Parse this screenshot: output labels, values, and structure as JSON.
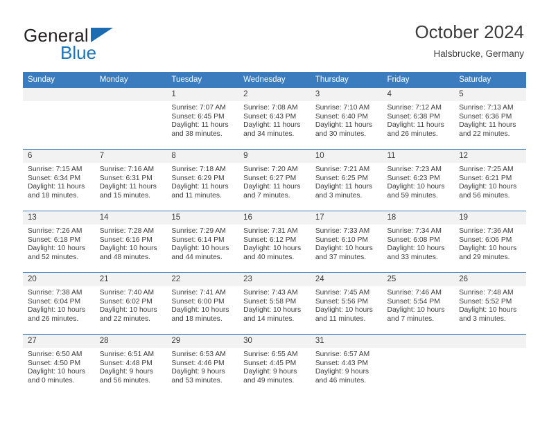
{
  "brand": {
    "name_part1": "General",
    "name_part2": "Blue",
    "logo_icon": "triangle-icon",
    "accent_color": "#1b75bb"
  },
  "header": {
    "title": "October 2024",
    "subtitle": "Halsbrucke, Germany"
  },
  "calendar": {
    "header_background": "#3a7cbe",
    "daynum_background": "#f2f2f2",
    "weekday_headers": [
      "Sunday",
      "Monday",
      "Tuesday",
      "Wednesday",
      "Thursday",
      "Friday",
      "Saturday"
    ],
    "weeks": [
      [
        {
          "day": "",
          "blank": true
        },
        {
          "day": "",
          "blank": true
        },
        {
          "day": "1",
          "sunrise": "Sunrise: 7:07 AM",
          "sunset": "Sunset: 6:45 PM",
          "daylight1": "Daylight: 11 hours",
          "daylight2": "and 38 minutes."
        },
        {
          "day": "2",
          "sunrise": "Sunrise: 7:08 AM",
          "sunset": "Sunset: 6:43 PM",
          "daylight1": "Daylight: 11 hours",
          "daylight2": "and 34 minutes."
        },
        {
          "day": "3",
          "sunrise": "Sunrise: 7:10 AM",
          "sunset": "Sunset: 6:40 PM",
          "daylight1": "Daylight: 11 hours",
          "daylight2": "and 30 minutes."
        },
        {
          "day": "4",
          "sunrise": "Sunrise: 7:12 AM",
          "sunset": "Sunset: 6:38 PM",
          "daylight1": "Daylight: 11 hours",
          "daylight2": "and 26 minutes."
        },
        {
          "day": "5",
          "sunrise": "Sunrise: 7:13 AM",
          "sunset": "Sunset: 6:36 PM",
          "daylight1": "Daylight: 11 hours",
          "daylight2": "and 22 minutes."
        }
      ],
      [
        {
          "day": "6",
          "sunrise": "Sunrise: 7:15 AM",
          "sunset": "Sunset: 6:34 PM",
          "daylight1": "Daylight: 11 hours",
          "daylight2": "and 18 minutes."
        },
        {
          "day": "7",
          "sunrise": "Sunrise: 7:16 AM",
          "sunset": "Sunset: 6:31 PM",
          "daylight1": "Daylight: 11 hours",
          "daylight2": "and 15 minutes."
        },
        {
          "day": "8",
          "sunrise": "Sunrise: 7:18 AM",
          "sunset": "Sunset: 6:29 PM",
          "daylight1": "Daylight: 11 hours",
          "daylight2": "and 11 minutes."
        },
        {
          "day": "9",
          "sunrise": "Sunrise: 7:20 AM",
          "sunset": "Sunset: 6:27 PM",
          "daylight1": "Daylight: 11 hours",
          "daylight2": "and 7 minutes."
        },
        {
          "day": "10",
          "sunrise": "Sunrise: 7:21 AM",
          "sunset": "Sunset: 6:25 PM",
          "daylight1": "Daylight: 11 hours",
          "daylight2": "and 3 minutes."
        },
        {
          "day": "11",
          "sunrise": "Sunrise: 7:23 AM",
          "sunset": "Sunset: 6:23 PM",
          "daylight1": "Daylight: 10 hours",
          "daylight2": "and 59 minutes."
        },
        {
          "day": "12",
          "sunrise": "Sunrise: 7:25 AM",
          "sunset": "Sunset: 6:21 PM",
          "daylight1": "Daylight: 10 hours",
          "daylight2": "and 56 minutes."
        }
      ],
      [
        {
          "day": "13",
          "sunrise": "Sunrise: 7:26 AM",
          "sunset": "Sunset: 6:18 PM",
          "daylight1": "Daylight: 10 hours",
          "daylight2": "and 52 minutes."
        },
        {
          "day": "14",
          "sunrise": "Sunrise: 7:28 AM",
          "sunset": "Sunset: 6:16 PM",
          "daylight1": "Daylight: 10 hours",
          "daylight2": "and 48 minutes."
        },
        {
          "day": "15",
          "sunrise": "Sunrise: 7:29 AM",
          "sunset": "Sunset: 6:14 PM",
          "daylight1": "Daylight: 10 hours",
          "daylight2": "and 44 minutes."
        },
        {
          "day": "16",
          "sunrise": "Sunrise: 7:31 AM",
          "sunset": "Sunset: 6:12 PM",
          "daylight1": "Daylight: 10 hours",
          "daylight2": "and 40 minutes."
        },
        {
          "day": "17",
          "sunrise": "Sunrise: 7:33 AM",
          "sunset": "Sunset: 6:10 PM",
          "daylight1": "Daylight: 10 hours",
          "daylight2": "and 37 minutes."
        },
        {
          "day": "18",
          "sunrise": "Sunrise: 7:34 AM",
          "sunset": "Sunset: 6:08 PM",
          "daylight1": "Daylight: 10 hours",
          "daylight2": "and 33 minutes."
        },
        {
          "day": "19",
          "sunrise": "Sunrise: 7:36 AM",
          "sunset": "Sunset: 6:06 PM",
          "daylight1": "Daylight: 10 hours",
          "daylight2": "and 29 minutes."
        }
      ],
      [
        {
          "day": "20",
          "sunrise": "Sunrise: 7:38 AM",
          "sunset": "Sunset: 6:04 PM",
          "daylight1": "Daylight: 10 hours",
          "daylight2": "and 26 minutes."
        },
        {
          "day": "21",
          "sunrise": "Sunrise: 7:40 AM",
          "sunset": "Sunset: 6:02 PM",
          "daylight1": "Daylight: 10 hours",
          "daylight2": "and 22 minutes."
        },
        {
          "day": "22",
          "sunrise": "Sunrise: 7:41 AM",
          "sunset": "Sunset: 6:00 PM",
          "daylight1": "Daylight: 10 hours",
          "daylight2": "and 18 minutes."
        },
        {
          "day": "23",
          "sunrise": "Sunrise: 7:43 AM",
          "sunset": "Sunset: 5:58 PM",
          "daylight1": "Daylight: 10 hours",
          "daylight2": "and 14 minutes."
        },
        {
          "day": "24",
          "sunrise": "Sunrise: 7:45 AM",
          "sunset": "Sunset: 5:56 PM",
          "daylight1": "Daylight: 10 hours",
          "daylight2": "and 11 minutes."
        },
        {
          "day": "25",
          "sunrise": "Sunrise: 7:46 AM",
          "sunset": "Sunset: 5:54 PM",
          "daylight1": "Daylight: 10 hours",
          "daylight2": "and 7 minutes."
        },
        {
          "day": "26",
          "sunrise": "Sunrise: 7:48 AM",
          "sunset": "Sunset: 5:52 PM",
          "daylight1": "Daylight: 10 hours",
          "daylight2": "and 3 minutes."
        }
      ],
      [
        {
          "day": "27",
          "sunrise": "Sunrise: 6:50 AM",
          "sunset": "Sunset: 4:50 PM",
          "daylight1": "Daylight: 10 hours",
          "daylight2": "and 0 minutes."
        },
        {
          "day": "28",
          "sunrise": "Sunrise: 6:51 AM",
          "sunset": "Sunset: 4:48 PM",
          "daylight1": "Daylight: 9 hours",
          "daylight2": "and 56 minutes."
        },
        {
          "day": "29",
          "sunrise": "Sunrise: 6:53 AM",
          "sunset": "Sunset: 4:46 PM",
          "daylight1": "Daylight: 9 hours",
          "daylight2": "and 53 minutes."
        },
        {
          "day": "30",
          "sunrise": "Sunrise: 6:55 AM",
          "sunset": "Sunset: 4:45 PM",
          "daylight1": "Daylight: 9 hours",
          "daylight2": "and 49 minutes."
        },
        {
          "day": "31",
          "sunrise": "Sunrise: 6:57 AM",
          "sunset": "Sunset: 4:43 PM",
          "daylight1": "Daylight: 9 hours",
          "daylight2": "and 46 minutes."
        },
        {
          "day": "",
          "blank": true
        },
        {
          "day": "",
          "blank": true
        }
      ]
    ]
  }
}
